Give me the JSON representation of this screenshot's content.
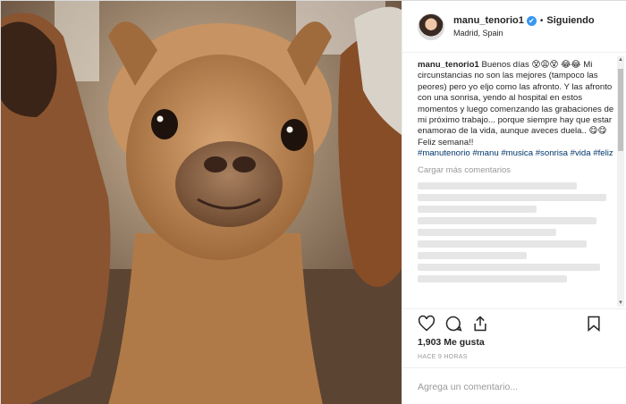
{
  "post": {
    "image_alt": "Alpaca smiling at the camera",
    "header": {
      "username": "manu_tenorio1",
      "verified_glyph": "✔",
      "separator": "•",
      "follow_label": "Siguiendo",
      "location": "Madrid, Spain"
    },
    "caption": {
      "username": "manu_tenorio1",
      "text": "Buenos días 😵😩😵 😂😂 Mi circunstancias no son las mejores (tampoco las peores) pero yo eljo como las afronto. Y las afronto con una sonrisa, yendo al hospital en estos momentos y luego comenzando las grabaciones de mi próximo trabajo... porque siempre hay que estar enamorao de la vida, aunque aveces duela.. 😋😋 Feliz semana!!",
      "hashtags": "#manutenorio #manu #musica #sonrisa #vida #feliz"
    },
    "load_more_label": "Cargar más comentarios",
    "likes": "1,903 Me gusta",
    "time": "HACE 9 HORAS",
    "add_comment_placeholder": "Agrega un comentario...",
    "scroll_up": "▲",
    "scroll_down": "▼"
  },
  "colors": {
    "link": "#003569",
    "muted": "#999999",
    "verified": "#3897f0",
    "border": "#efefef"
  }
}
